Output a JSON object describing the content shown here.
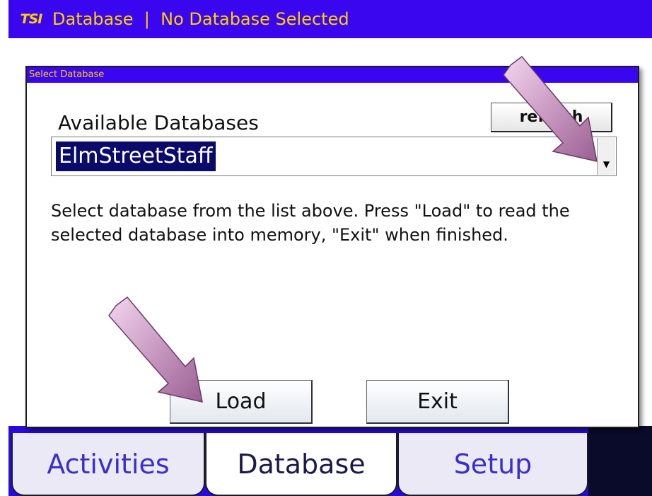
{
  "header": {
    "logo": "TSI",
    "title": "Database  |  No Database Selected"
  },
  "dialog": {
    "title": "Select Database",
    "available_label": "Available Databases",
    "refresh_label": "refresh",
    "selected_database": "ElmStreetStaff",
    "instructions": "Select database from the list above.  Press \"Load\" to read the selected database into memory, \"Exit\" when finished.",
    "load_label": "Load",
    "exit_label": "Exit"
  },
  "tabs": [
    {
      "label": "Activities",
      "active": false
    },
    {
      "label": "Database",
      "active": true
    },
    {
      "label": "Setup",
      "active": false
    }
  ],
  "colors": {
    "title_bar": "#3a06f0",
    "title_text": "#ffd000",
    "selection": "#0a0a6b",
    "arrow": "#c9a0c4"
  },
  "icons": {
    "logo": "tsi-logo-icon",
    "dropdown": "chevron-down-icon",
    "pointer_arrows": "arrow-icon"
  }
}
